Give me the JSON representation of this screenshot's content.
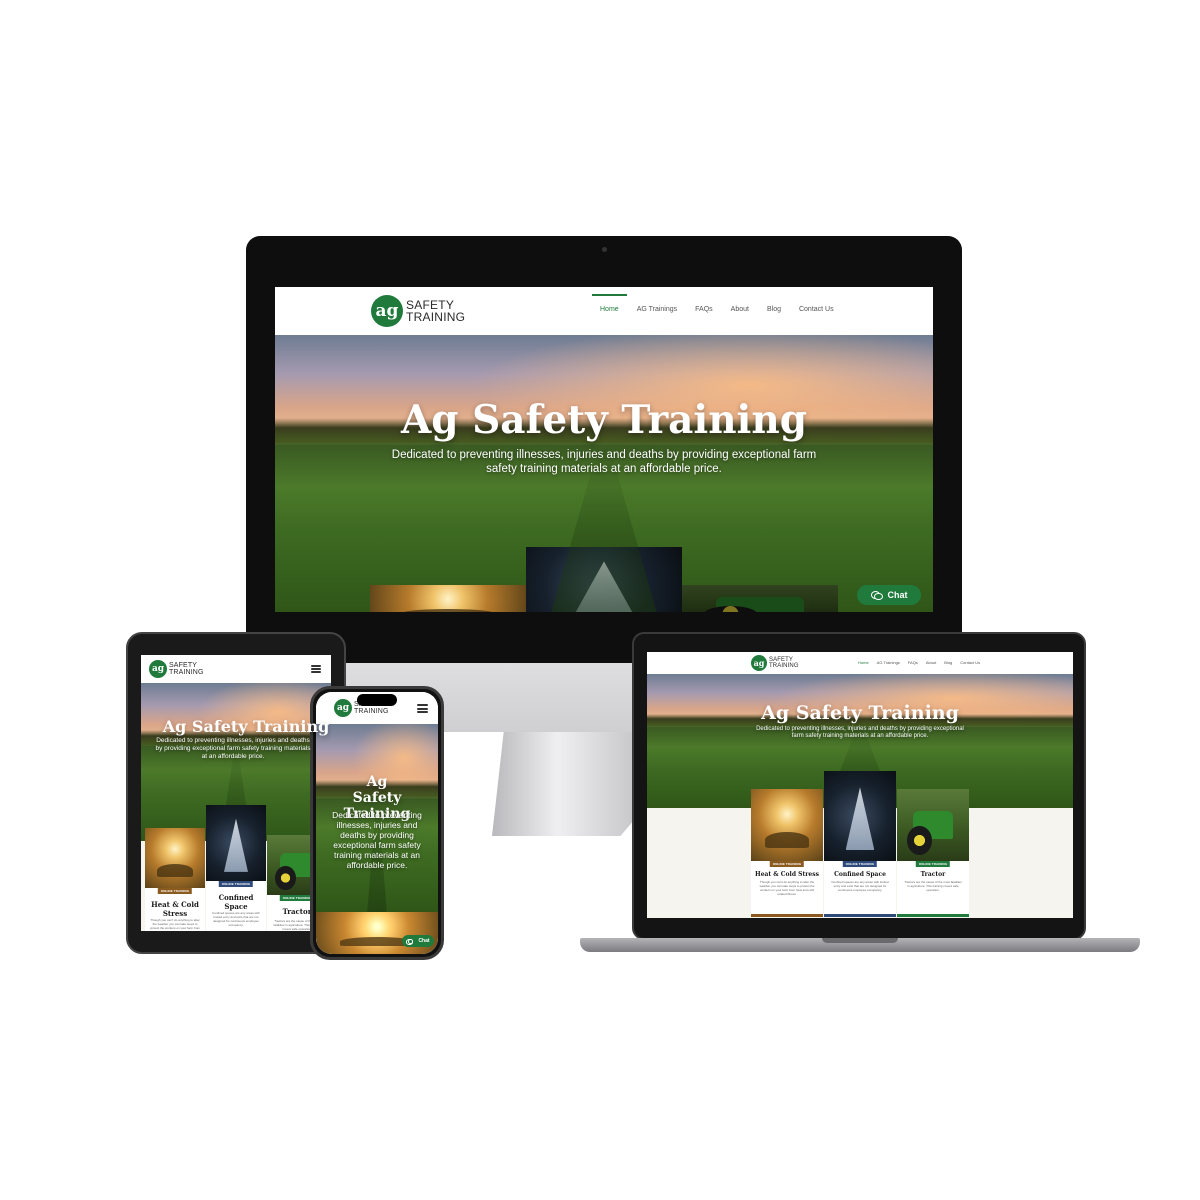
{
  "site": {
    "logo_big": "ag",
    "logo_line1": "SAFETY",
    "logo_line2": "TRAINING",
    "nav": [
      "Home",
      "AG Trainings",
      "FAQs",
      "About",
      "Blog",
      "Contact Us"
    ],
    "hero_title": "Ag Safety Training",
    "hero_subtitle": "Dedicated to preventing illnesses, injuries and deaths by providing exceptional farm safety training materials at an affordable price.",
    "chat_label": "Chat",
    "cards": [
      {
        "tag": "ONLINE TRAINING",
        "title": "Heat & Cold Stress",
        "text": "Though you can't do anything to alter the weather you can take steps to protect the workers on your farm from heat and cold related illness.",
        "image": "sunset-hay-bale"
      },
      {
        "tag": "ONLINE TRAINING",
        "title": "Confined Space",
        "text": "Confined spaces are any areas with limited entry and exits that are not designed for continuous employee occupancy.",
        "image": "confined-space-worker"
      },
      {
        "tag": "ONLINE TRAINING",
        "title": "Tractor",
        "text": "Tractors are the cause of the most fatalities in agriculture. This training covers safe operation.",
        "image": "green-tractor"
      }
    ]
  },
  "colors": {
    "brand_green": "#1f7a3c",
    "tag_brown": "#8b5a1e",
    "tag_blue": "#2d4a7a",
    "page_bg": "#f6f4ee"
  },
  "icons": {
    "chat": "chat-bubbles-icon",
    "menu": "hamburger-menu-icon"
  }
}
